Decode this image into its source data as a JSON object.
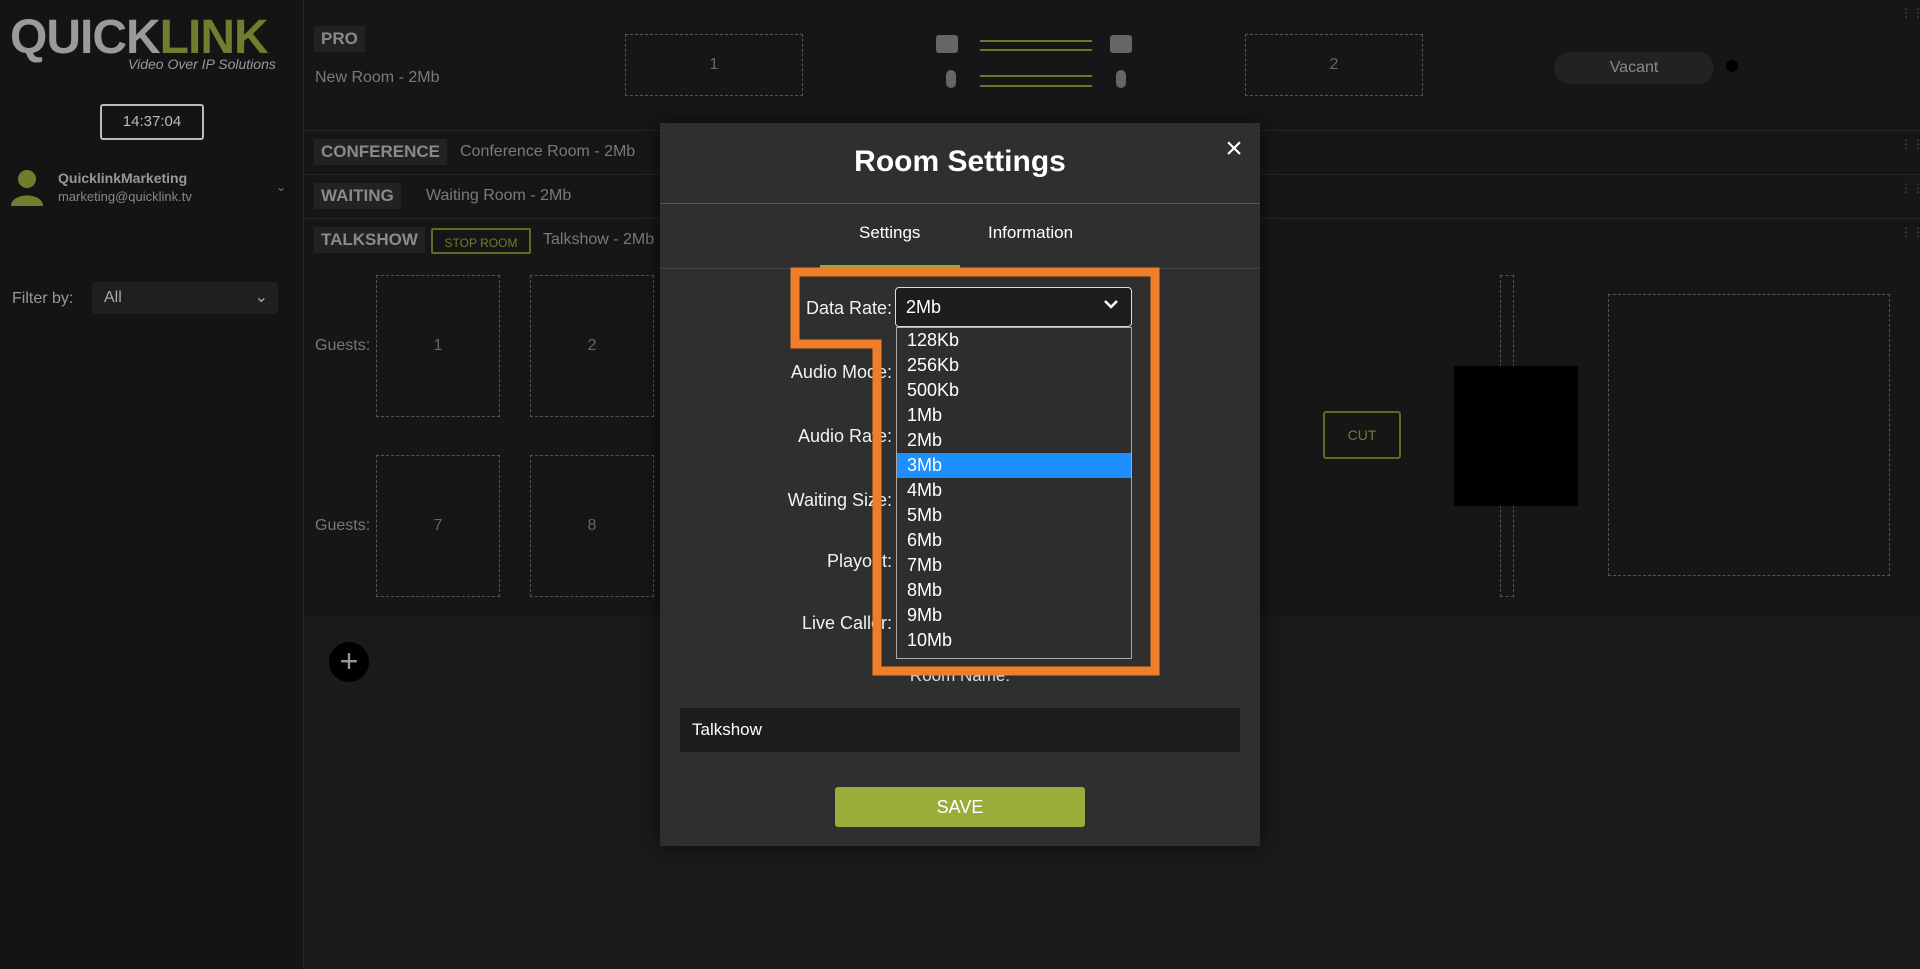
{
  "brand": {
    "logo_quick": "QUICK",
    "logo_link": "LINK",
    "tagline": "Video Over IP Solutions"
  },
  "sidebar": {
    "clock": "14:37:04",
    "user_name": "QuicklinkMarketing",
    "user_email": "marketing@quicklink.tv",
    "filter_label": "Filter by:",
    "filter_value": "All"
  },
  "rooms": {
    "pro": {
      "tag": "PRO",
      "name": "New Room - 2Mb",
      "slot1": "1",
      "slot2": "2",
      "status": "Vacant"
    },
    "conference": {
      "tag": "CONFERENCE",
      "name": "Conference Room - 2Mb"
    },
    "waiting": {
      "tag": "WAITING",
      "name": "Waiting Room - 2Mb"
    },
    "talkshow": {
      "tag": "TALKSHOW",
      "stop_label": "STOP ROOM",
      "name": "Talkshow - 2Mb",
      "guests_label": "Guests:",
      "row1": [
        "1",
        "2"
      ],
      "row2": [
        "7",
        "8"
      ],
      "cut_label": "CUT"
    }
  },
  "modal": {
    "title": "Room Settings",
    "tabs": [
      "Settings",
      "Information"
    ],
    "active_tab": "Settings",
    "fields": {
      "data_rate": "Data Rate:",
      "audio_mode": "Audio Mode:",
      "audio_rate": "Audio Rate:",
      "waiting_size": "Waiting Size:",
      "playout": "Playout:",
      "live_caller": "Live Caller:"
    },
    "data_rate_value": "2Mb",
    "data_rate_options": [
      "128Kb",
      "256Kb",
      "500Kb",
      "1Mb",
      "2Mb",
      "3Mb",
      "4Mb",
      "5Mb",
      "6Mb",
      "7Mb",
      "8Mb",
      "9Mb",
      "10Mb"
    ],
    "highlighted_option": "3Mb",
    "room_name_label": "Room Name:",
    "room_name_value": "Talkshow",
    "save_label": "SAVE"
  },
  "colors": {
    "accent_green": "#9aad3a",
    "highlight_orange": "#f07d2a",
    "selected_blue": "#1e8fff"
  }
}
